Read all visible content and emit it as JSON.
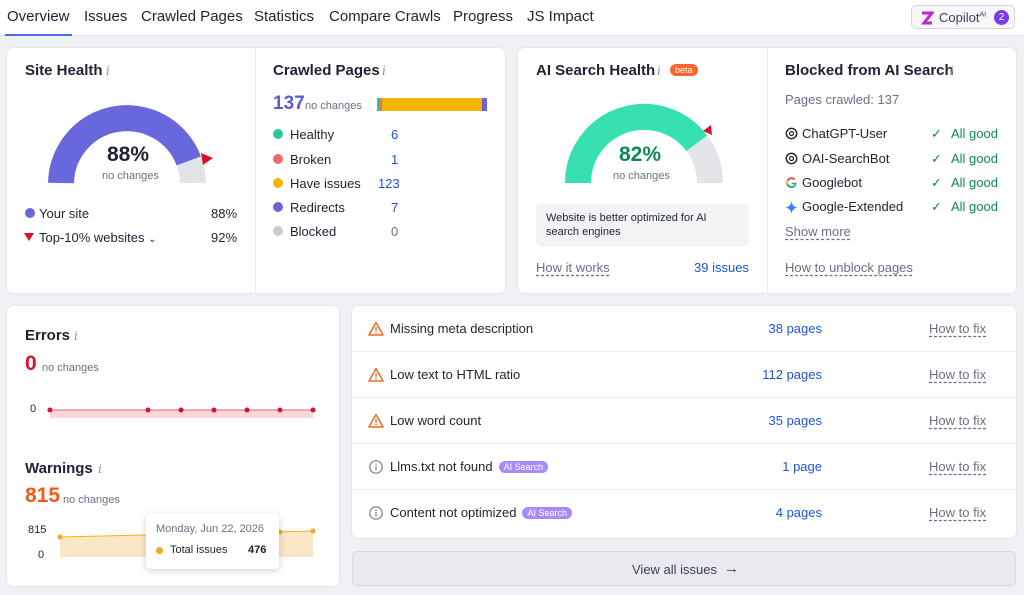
{
  "tabs": [
    "Overview",
    "Issues",
    "Crawled Pages",
    "Statistics",
    "Compare Crawls",
    "Progress",
    "JS Impact"
  ],
  "copilot": {
    "label": "Copilot",
    "sup": "AI",
    "count": "2"
  },
  "site_health": {
    "title": "Site Health",
    "value": "88%",
    "sub": "no changes",
    "legend": [
      {
        "label": "Your site",
        "value": "88%"
      },
      {
        "label": "Top-10% websites",
        "value": "92%"
      }
    ]
  },
  "crawled_pages": {
    "title": "Crawled Pages",
    "total": "137",
    "sub": "no changes",
    "rows": [
      {
        "label": "Healthy",
        "value": "6",
        "color": "#2dc59a"
      },
      {
        "label": "Broken",
        "value": "1",
        "color": "#ef6b6b"
      },
      {
        "label": "Have issues",
        "value": "123",
        "color": "#f5b400"
      },
      {
        "label": "Redirects",
        "value": "7",
        "color": "#6d63d9"
      },
      {
        "label": "Blocked",
        "value": "0",
        "color": "#c9cbd3"
      }
    ]
  },
  "ai_health": {
    "title": "AI Search Health",
    "beta": "beta",
    "value": "82%",
    "sub": "no changes",
    "note": "Website is better optimized for AI search engines",
    "how": "How it works",
    "issues": "39 issues"
  },
  "blocked": {
    "title": "Blocked from AI Search",
    "pages_crawled": "Pages crawled: 137",
    "bots": [
      {
        "name": "ChatGPT-User",
        "status": "All good",
        "icon": "openai-icon"
      },
      {
        "name": "OAI-SearchBot",
        "status": "All good",
        "icon": "openai-icon"
      },
      {
        "name": "Googlebot",
        "status": "All good",
        "icon": "google-icon"
      },
      {
        "name": "Google-Extended",
        "status": "All good",
        "icon": "gemini-icon"
      }
    ],
    "show_more": "Show more",
    "unblock": "How to unblock pages"
  },
  "errors": {
    "title": "Errors",
    "value": "0",
    "sub": "no changes",
    "axis": "0"
  },
  "warnings": {
    "title": "Warnings",
    "value": "815",
    "sub": "no changes",
    "axis_top": "815",
    "axis_bottom": "0",
    "tooltip": {
      "date": "Monday, Jun 22, 2026",
      "label": "Total issues",
      "value": "476"
    }
  },
  "issues": [
    {
      "name": "Missing meta description",
      "pages": "38 pages",
      "fix": "How to fix",
      "type": "warning",
      "ai": ""
    },
    {
      "name": "Low text to HTML ratio",
      "pages": "112 pages",
      "fix": "How to fix",
      "type": "warning",
      "ai": ""
    },
    {
      "name": "Low word count",
      "pages": "35 pages",
      "fix": "How to fix",
      "type": "warning",
      "ai": ""
    },
    {
      "name": "Llms.txt not found",
      "pages": "1 page",
      "fix": "How to fix",
      "type": "notice",
      "ai": "AI Search"
    },
    {
      "name": "Content not optimized",
      "pages": "4 pages",
      "fix": "How to fix",
      "type": "notice",
      "ai": "AI Search"
    }
  ],
  "view_all": "View all issues"
}
